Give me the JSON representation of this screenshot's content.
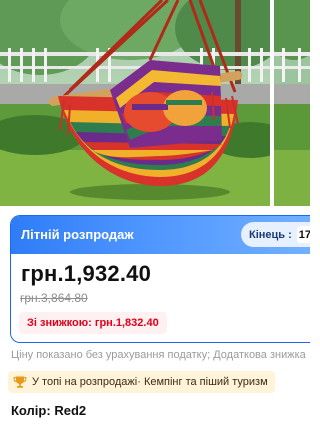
{
  "gallery": {
    "main_image": "hammock-chair-rainbow-stripes",
    "next_image": "hammock-chair-preview"
  },
  "promo": {
    "title": "Літній розпродаж",
    "timer_label": "Кінець :",
    "timer_value": "17",
    "price_current": "грн.1,932.40",
    "price_old": "грн.3,864.80",
    "coupon_text": "Зі знижкою: грн.1,832.40",
    "colors": {
      "accent_blue": "#1769f3",
      "coupon_red": "#e2001a"
    }
  },
  "tax_note": "Ціну показано без урахування податку; Додаткова знижка",
  "ranking": {
    "icon": "trophy-icon",
    "text": "У топі на розпродажі· Кемпінг та піший туризм"
  },
  "color_selector": {
    "label": "Колір:",
    "value": "Red2"
  }
}
